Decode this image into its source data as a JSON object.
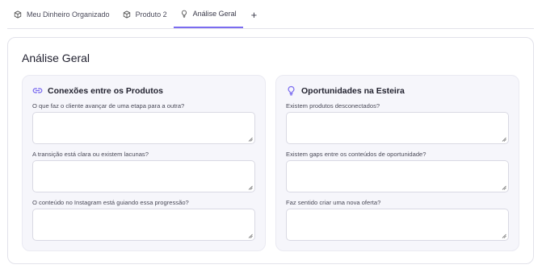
{
  "tabs": [
    {
      "label": "Meu Dinheiro Organizado",
      "icon": "box-icon"
    },
    {
      "label": "Produto 2",
      "icon": "box-icon"
    },
    {
      "label": "Análise Geral",
      "icon": "lightbulb-icon",
      "active": true
    }
  ],
  "add_tab_label": "+",
  "accent_color": "#7b6cf0",
  "page": {
    "title": "Análise Geral"
  },
  "left_panel": {
    "title": "Conexões entre os Produtos",
    "icon": "link-icon",
    "questions": [
      {
        "label": "O que faz o cliente avançar de uma etapa para a outra?",
        "value": ""
      },
      {
        "label": "A transição está clara ou existem lacunas?",
        "value": ""
      },
      {
        "label": "O conteúdo no Instagram está guiando essa progressão?",
        "value": ""
      }
    ]
  },
  "right_panel": {
    "title": "Oportunidades na Esteira",
    "icon": "lightbulb-icon",
    "questions": [
      {
        "label": "Existem produtos desconectados?",
        "value": ""
      },
      {
        "label": "Existem gaps entre os conteúdos de oportunidade?",
        "value": ""
      },
      {
        "label": "Faz sentido criar uma nova oferta?",
        "value": ""
      }
    ]
  }
}
